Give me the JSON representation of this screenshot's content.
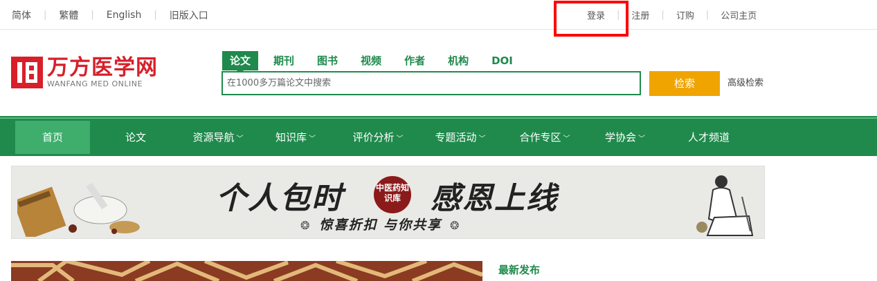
{
  "top_bar": {
    "languages": [
      "简体",
      "繁體",
      "English",
      "旧版入口"
    ],
    "user_links": [
      "登录",
      "注册",
      "订购",
      "公司主页"
    ]
  },
  "logo": {
    "cn": "万方医学网",
    "en": "WANFANG MED ONLINE"
  },
  "search": {
    "tabs": [
      "论文",
      "期刊",
      "图书",
      "视频",
      "作者",
      "机构",
      "DOI"
    ],
    "active_tab": "论文",
    "placeholder": "在1000多万篇论文中搜索",
    "button_label": "检索",
    "advanced_label": "高级检索"
  },
  "nav": {
    "items": [
      {
        "label": "首页",
        "dropdown": false
      },
      {
        "label": "论文",
        "dropdown": false
      },
      {
        "label": "资源导航",
        "dropdown": true
      },
      {
        "label": "知识库",
        "dropdown": true
      },
      {
        "label": "评价分析",
        "dropdown": true
      },
      {
        "label": "专题活动",
        "dropdown": true
      },
      {
        "label": "合作专区",
        "dropdown": true
      },
      {
        "label": "学协会",
        "dropdown": true
      },
      {
        "label": "人才频道",
        "dropdown": false
      }
    ],
    "active": "首页"
  },
  "banner": {
    "headline_left": "个人包时",
    "seal": "中医药知识库",
    "headline_right": "感恩上线",
    "subline": "惊喜折扣 与你共享"
  },
  "latest_title": "最新发布",
  "colors": {
    "brand_green": "#1f8a4c",
    "brand_red": "#d81f2a",
    "search_orange": "#f0a400",
    "highlight": "#ff0000"
  }
}
